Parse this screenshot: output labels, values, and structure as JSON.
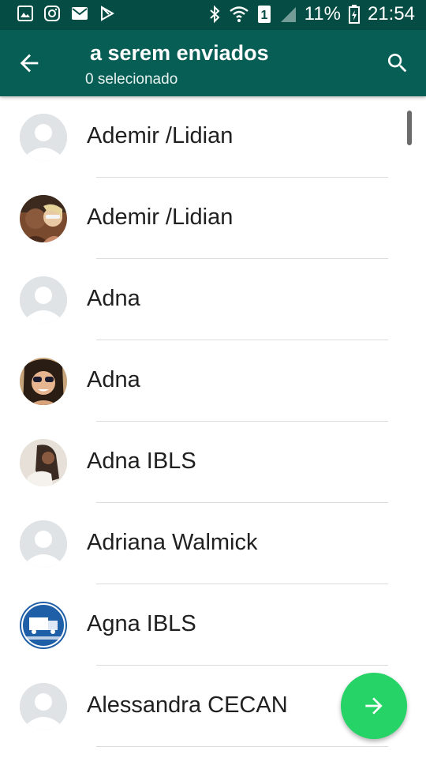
{
  "status_bar": {
    "battery": "11%",
    "time": "21:54",
    "left_icons": [
      "gallery-icon",
      "instagram-icon",
      "mail-icon",
      "play-store-icon"
    ],
    "right_icons": [
      "bluetooth-icon",
      "wifi-icon",
      "sim-1-icon",
      "signal-icon",
      "battery-icon"
    ]
  },
  "header": {
    "title": "a serem enviados",
    "subtitle": "0 selecionado",
    "back_icon": "arrow-back-icon",
    "search_icon": "search-icon"
  },
  "contacts": [
    {
      "name": "Ademir /Lidian",
      "avatar": "default-avatar"
    },
    {
      "name": "Ademir /Lidian",
      "avatar": "photo-couple"
    },
    {
      "name": "Adna",
      "avatar": "default-avatar"
    },
    {
      "name": "Adna",
      "avatar": "photo-woman-sunglasses"
    },
    {
      "name": "Adna IBLS",
      "avatar": "photo-person"
    },
    {
      "name": "Adriana Walmick",
      "avatar": "default-avatar"
    },
    {
      "name": "Agna IBLS",
      "avatar": "photo-truck-logo"
    },
    {
      "name": "Alessandra CECAN",
      "avatar": "default-avatar"
    }
  ],
  "fab": {
    "icon": "arrow-forward-icon"
  },
  "colors": {
    "status_bar": "#054d44",
    "app_bar": "#075e54",
    "fab": "#25d366"
  }
}
